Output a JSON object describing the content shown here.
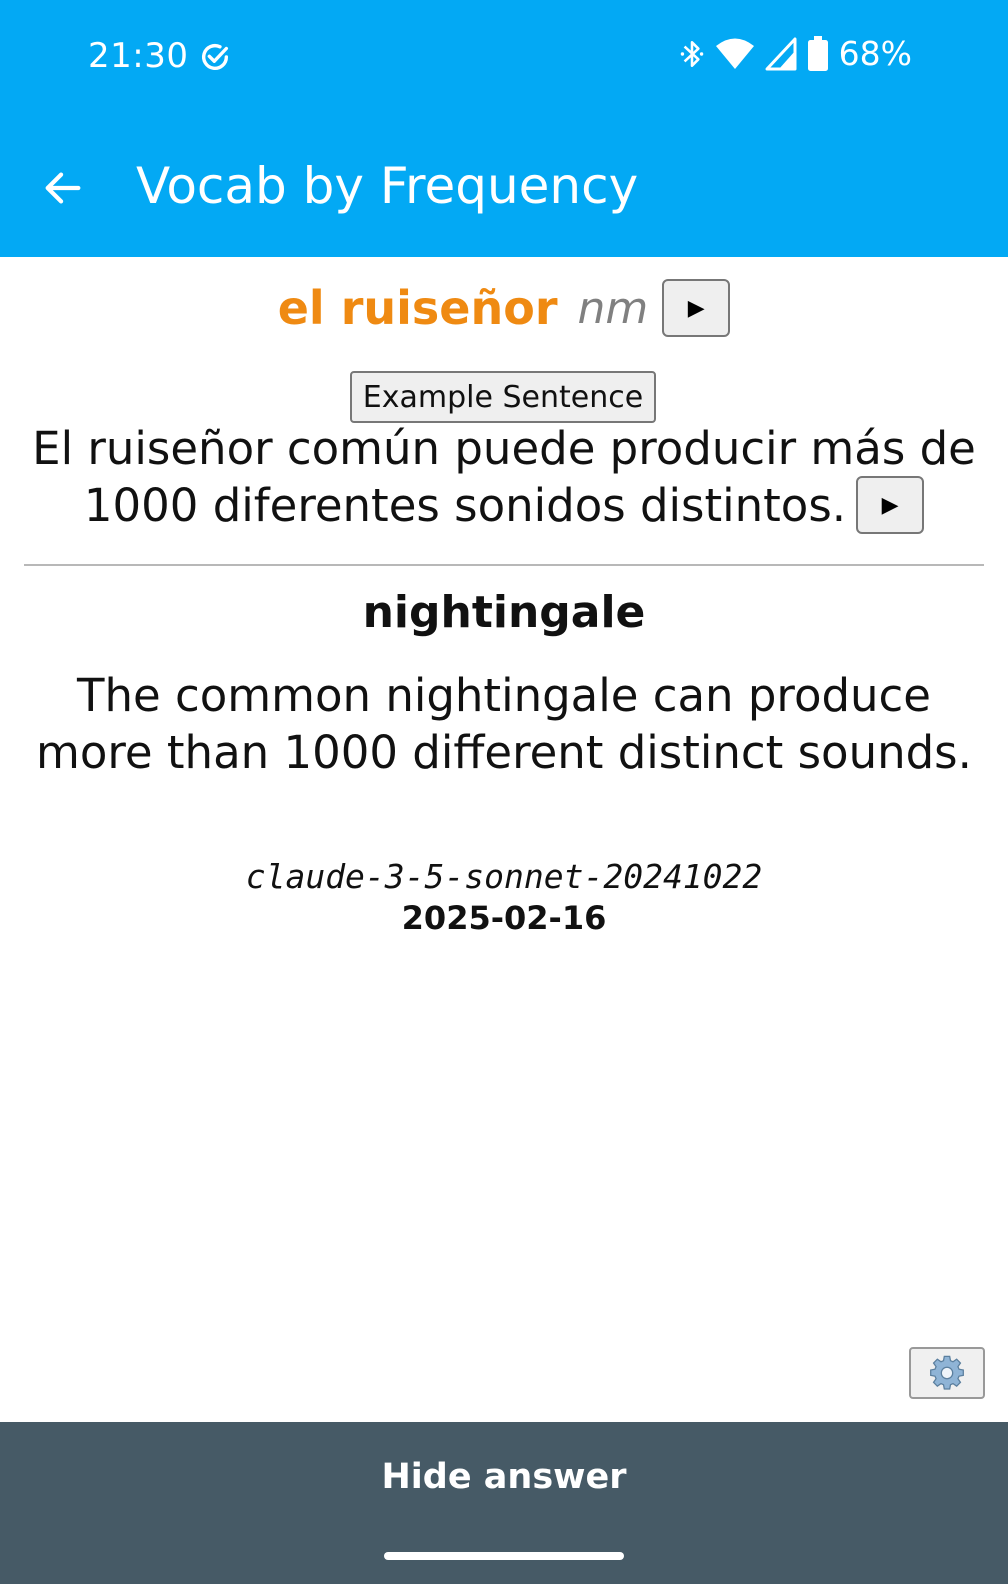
{
  "status_bar": {
    "time": "21:30",
    "battery_percent": "68%",
    "icons": [
      "check-circle-icon",
      "bluetooth-icon",
      "wifi-icon",
      "signal-icon",
      "battery-icon"
    ]
  },
  "app_bar": {
    "title": "Vocab by Frequency",
    "color": "#03a9f4"
  },
  "card": {
    "word": "el ruiseñor",
    "part_of_speech": "nm",
    "play_symbol": "▶",
    "example_button_label": "Example Sentence",
    "example_sentence": "El ruiseñor común puede producir más de 1000 diferentes sonidos distintos.",
    "translation_word": "nightingale",
    "translation_sentence": "The common nightingale can produce more than 1000 different distinct sounds.",
    "model": "claude-3-5-sonnet-20241022",
    "date": "2025-02-16",
    "word_color": "#ef8a12"
  },
  "bottom_bar": {
    "hide_answer_label": "Hide answer",
    "color": "#465a66"
  }
}
